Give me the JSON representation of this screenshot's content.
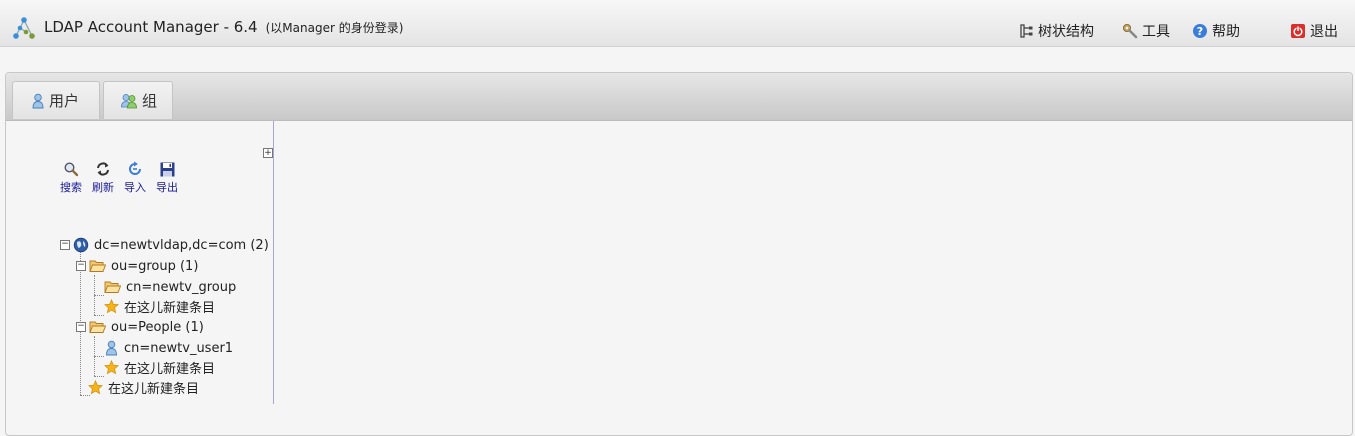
{
  "header": {
    "title": "LDAP Account Manager - 6.4",
    "login_note": "(以Manager 的身份登录)",
    "links": {
      "tree_view": "树状结构",
      "tools": "工具",
      "help": "帮助",
      "logout": "退出"
    }
  },
  "tabs": {
    "users": "用户",
    "groups": "组"
  },
  "tree_toolbar": {
    "search": "搜索",
    "refresh": "刷新",
    "import": "导入",
    "export": "导出"
  },
  "tree": {
    "root": "dc=newtvldap,dc=com (2)",
    "ou_group": "ou=group (1)",
    "cn_group": "cn=newtv_group",
    "new_entry_group": "在这儿新建条目",
    "ou_people": "ou=People (1)",
    "cn_user": "cn=newtv_user1",
    "new_entry_people": "在这儿新建条目",
    "new_entry_root": "在这儿新建条目"
  },
  "colors": {
    "toolbar_label": "#1a1a9c",
    "logout_icon": "#d9302c",
    "help_icon": "#3b7dd8",
    "folder": "#f0b84a",
    "star": "#f5b31a"
  }
}
